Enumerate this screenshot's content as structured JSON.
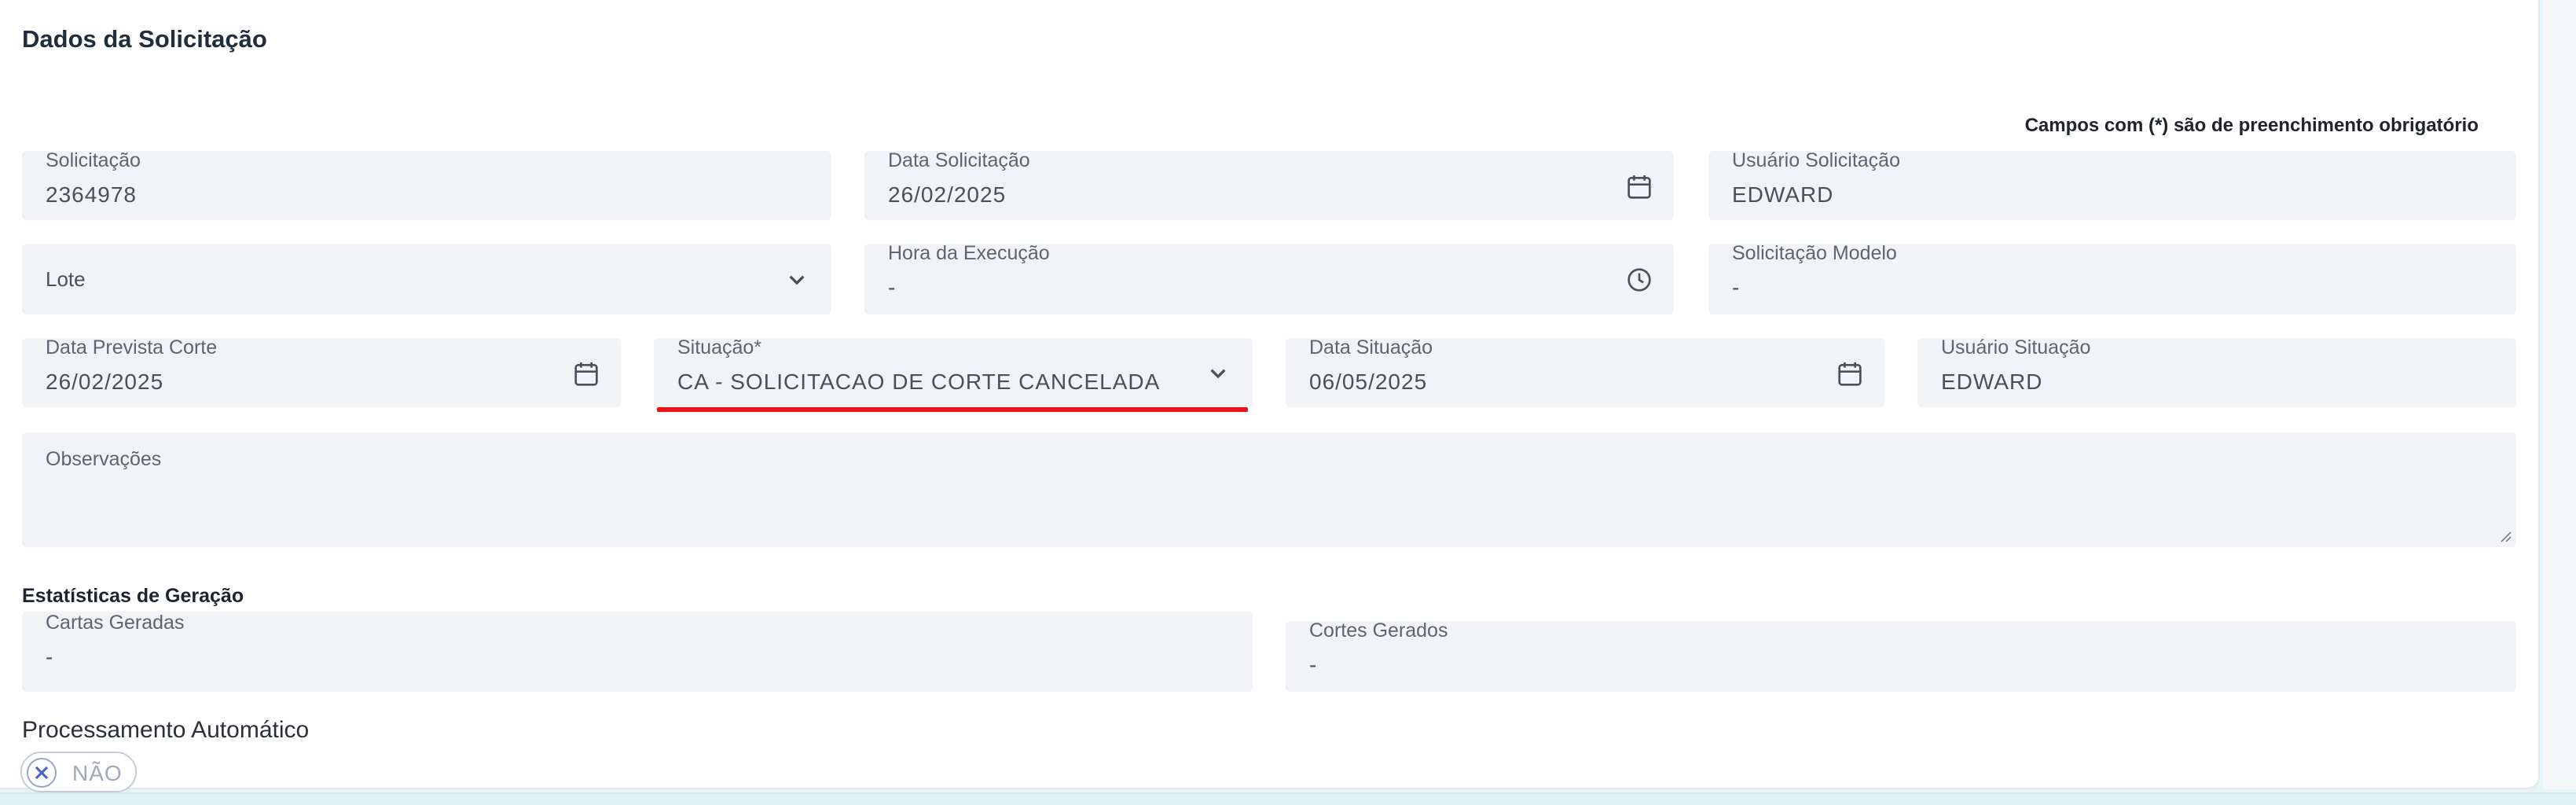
{
  "form": {
    "title": "Dados da Solicitação",
    "required_note": "Campos com (*) são de preenchimento obrigatório",
    "solicitacao": {
      "label": "Solicitação",
      "value": "2364978"
    },
    "data_solicitacao": {
      "label": "Data Solicitação",
      "value": "26/02/2025"
    },
    "usuario_solicitacao": {
      "label": "Usuário Solicitação",
      "value": "EDWARD"
    },
    "lote": {
      "placeholder": "Lote"
    },
    "hora_execucao": {
      "label": "Hora da Execução",
      "value": "-"
    },
    "solicitacao_modelo": {
      "label": "Solicitação Modelo",
      "value": "-"
    },
    "data_prevista_corte": {
      "label": "Data Prevista Corte",
      "value": "26/02/2025"
    },
    "situacao": {
      "label": "Situação*",
      "value": "CA - SOLICITACAO DE CORTE CANCELADA"
    },
    "data_situacao": {
      "label": "Data Situação",
      "value": "06/05/2025"
    },
    "usuario_situacao": {
      "label": "Usuário Situação",
      "value": "EDWARD"
    },
    "observacoes": {
      "label": "Observações",
      "value": ""
    }
  },
  "estatisticas": {
    "title": "Estatísticas de Geração",
    "cartas_geradas": {
      "label": "Cartas Geradas",
      "value": "-"
    },
    "cortes_gerados": {
      "label": "Cortes Gerados",
      "value": "-"
    }
  },
  "processamento": {
    "label": "Processamento Automático",
    "toggle_label": "NÃO"
  },
  "icons": {
    "calendar": "calendar-icon",
    "clock": "clock-icon",
    "chevron": "chevron-down-icon",
    "close": "close-icon"
  },
  "colors": {
    "field_bg": "#f1f3f7",
    "highlight_underline": "#e8141a",
    "title": "#1f2d3d"
  }
}
